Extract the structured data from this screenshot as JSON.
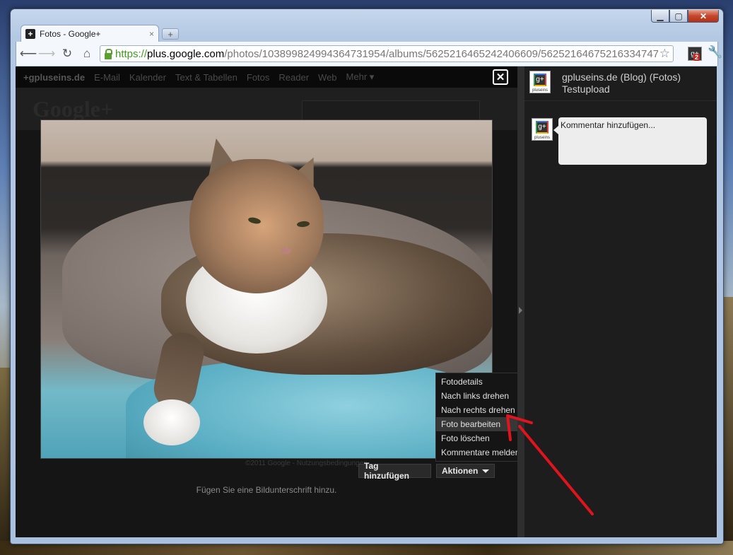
{
  "browser": {
    "tab_title": "Fotos - Google+",
    "tab_close": "×",
    "new_tab": "+",
    "url_scheme": "https://",
    "url_host": "plus.google.com",
    "url_path": "/photos/103899824994364731954/albums/5625216465242406609/56252164675216334747",
    "extension_badge": "2"
  },
  "gbar": {
    "items": [
      "+gpluseins.de",
      "E-Mail",
      "Kalender",
      "Text & Tabellen",
      "Fotos",
      "Reader",
      "Web",
      "Mehr ▾"
    ]
  },
  "header": {
    "logo": "Google+"
  },
  "viewer": {
    "close_symbol": "✕",
    "copyright": "©2011 Google - Nutzungsbedingungen",
    "tag_button": "Tag hinzufügen",
    "actions_button": "Aktionen",
    "caption_placeholder": "Fügen Sie eine Bildunterschrift hinzu."
  },
  "actions_menu": {
    "items": [
      {
        "label": "Fotodetails"
      },
      {
        "label": "Nach links drehen"
      },
      {
        "label": "Nach rechts drehen"
      },
      {
        "label": "Foto bearbeiten",
        "highlighted": true
      },
      {
        "label": "Foto löschen"
      },
      {
        "label": "Kommentare melden oder löschen"
      }
    ]
  },
  "panel": {
    "title_line1": "gpluseins.de (Blog) (Fotos)",
    "title_line2": "Testupload",
    "avatar_label": "pluseins",
    "avatar_glyph": "g+",
    "comment_placeholder": "Kommentar hinzufügen..."
  },
  "colors": {
    "accent_green": "#3d9c1e",
    "menu_highlight": "#373737",
    "annotation_arrow": "#e0141c"
  }
}
